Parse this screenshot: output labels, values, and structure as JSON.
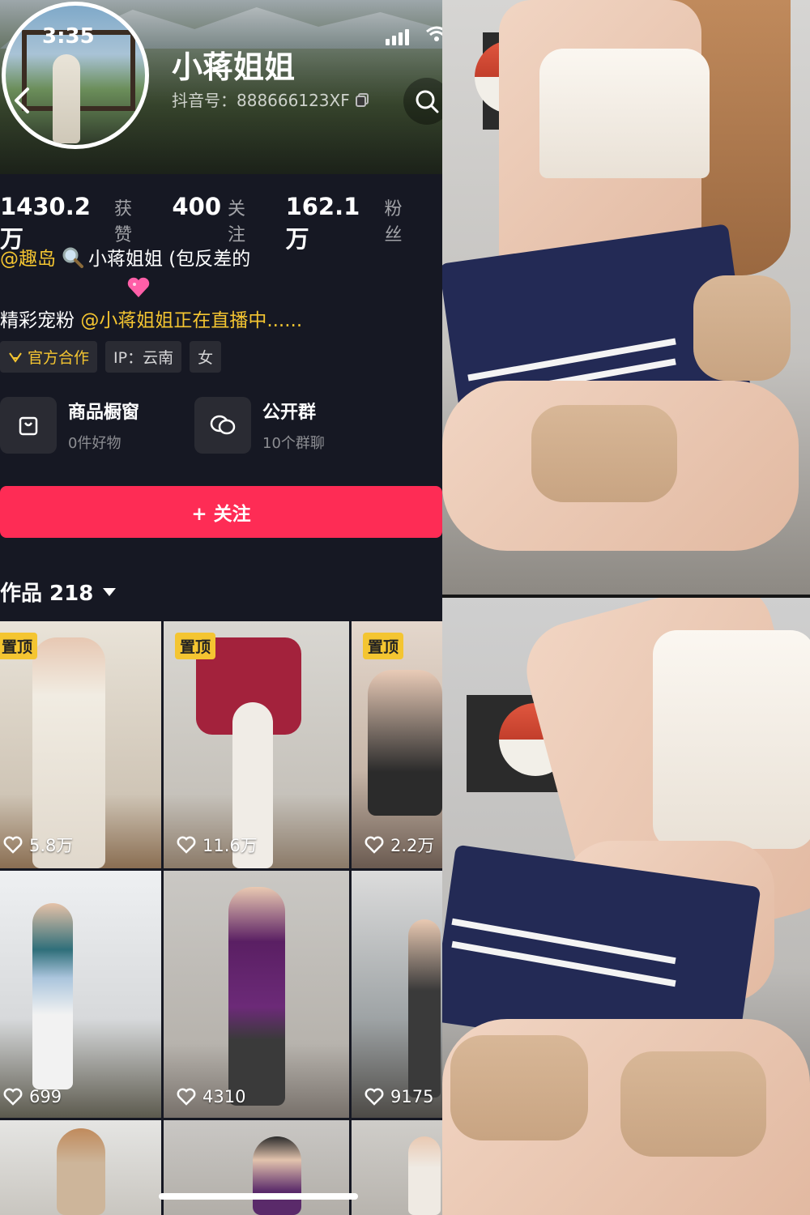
{
  "status": {
    "time": "3:35"
  },
  "profile": {
    "name": "小蒋姐姐",
    "douyin_id": "抖音号：888666123XF",
    "stats": [
      {
        "value": "1430.2万",
        "label": "获赞"
      },
      {
        "value": "400",
        "label": "关注"
      },
      {
        "value": "162.1万",
        "label": "粉丝"
      }
    ],
    "bio_line1_mention": "@趣岛",
    "bio_line1_text": "小蒋姐姐 (包反差的",
    "bio_line2_prefix": "精彩宠粉 ",
    "bio_line2_mention": "@小蒋姐姐正在直播中......",
    "tags": [
      "官方合作",
      "IP：云南",
      "女"
    ]
  },
  "cards": [
    {
      "title": "商品橱窗",
      "sub": "0件好物",
      "icon": "shop-bag-icon"
    },
    {
      "title": "公开群",
      "sub": "10个群聊",
      "icon": "chat-bubbles-icon"
    }
  ],
  "follow_label": "+ 关注",
  "works": {
    "label": "作品 218"
  },
  "videos": [
    {
      "pinned": true,
      "pin_label": "置顶",
      "likes": "5.8万"
    },
    {
      "pinned": true,
      "pin_label": "置顶",
      "likes": "11.6万"
    },
    {
      "pinned": true,
      "pin_label": "置顶",
      "likes": "2.2万"
    },
    {
      "pinned": false,
      "likes": "699"
    },
    {
      "pinned": false,
      "likes": "4310"
    },
    {
      "pinned": false,
      "likes": "9175"
    }
  ],
  "colors": {
    "accent": "#fe2c55",
    "mention": "#f4c531",
    "background": "#161823"
  }
}
